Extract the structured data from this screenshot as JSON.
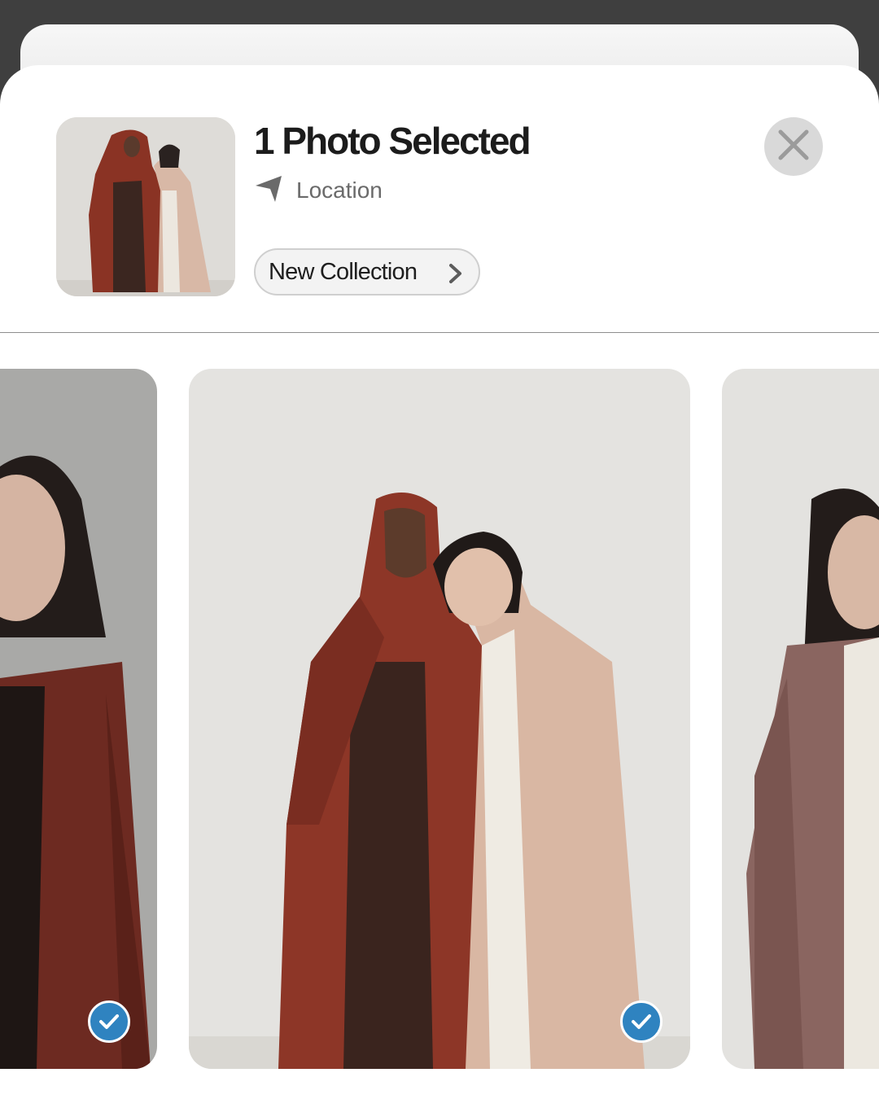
{
  "header": {
    "title": "1 Photo Selected",
    "location_label": "Location",
    "location_icon": "location-arrow-icon",
    "collection_label": "New Collection",
    "collection_icon": "chevron-right-icon",
    "close_icon": "close-icon"
  },
  "photos": [
    {
      "name": "photo-left",
      "selected": true
    },
    {
      "name": "photo-center",
      "selected": true
    },
    {
      "name": "photo-right",
      "selected": false
    }
  ],
  "colors": {
    "check_badge": "#2f83c0",
    "backdrop": "#3f3f3f",
    "sheet": "#ffffff"
  }
}
